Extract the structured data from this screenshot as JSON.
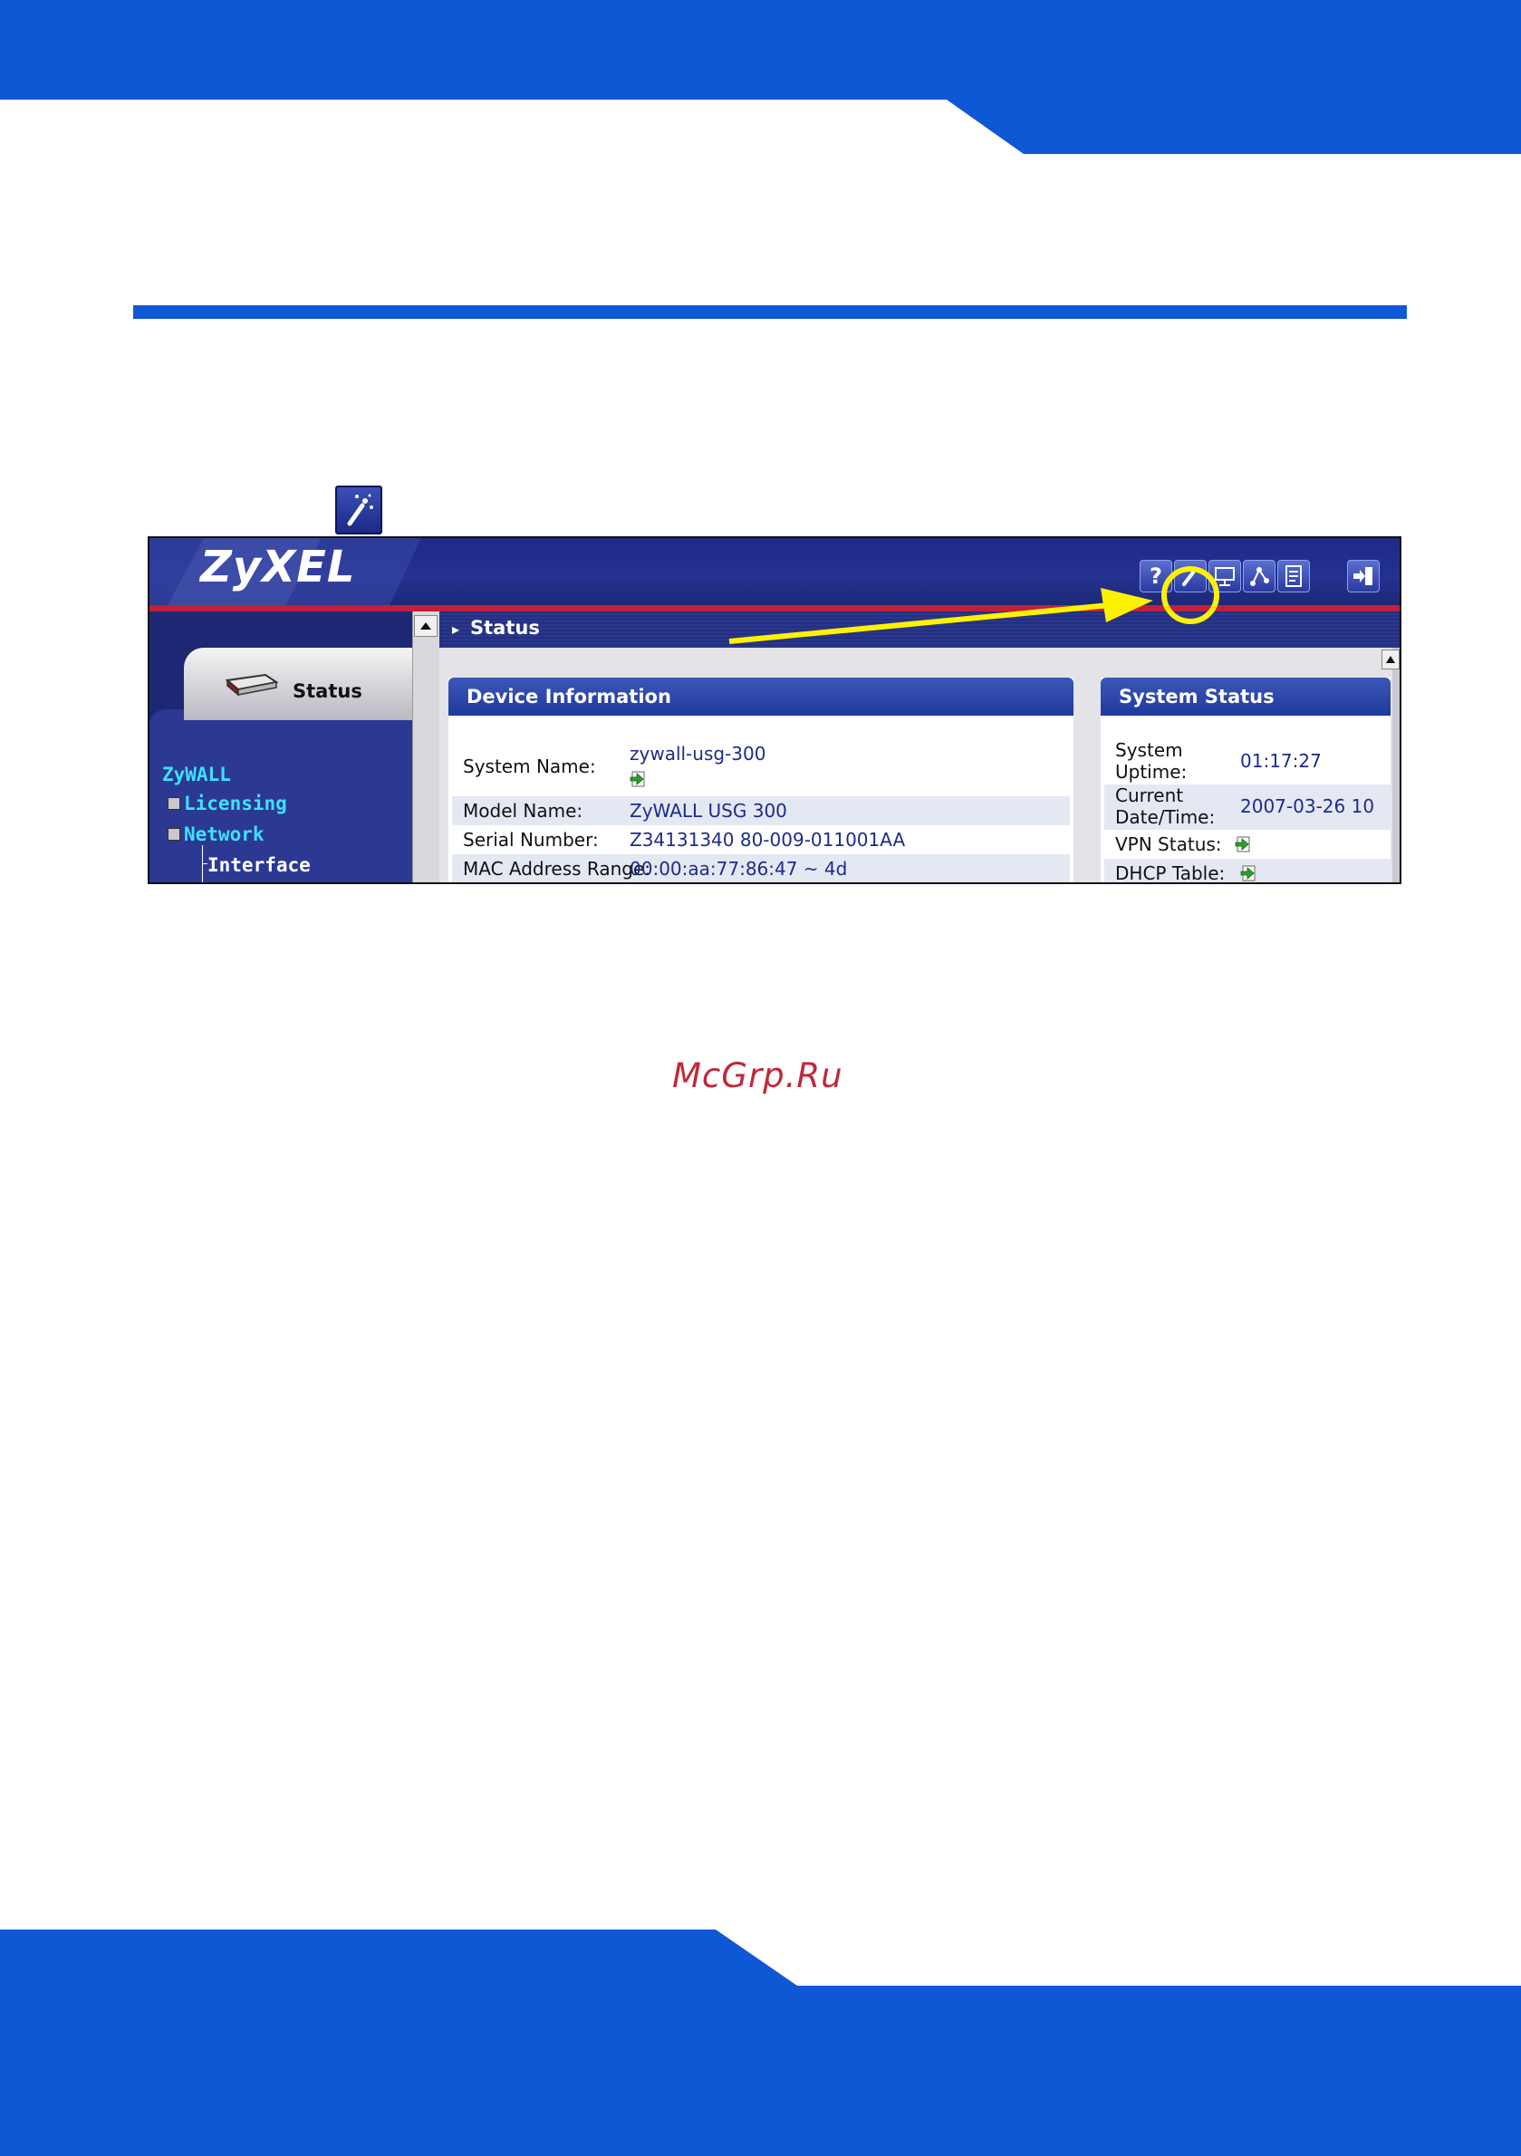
{
  "header": {
    "logo": "ZyXEL"
  },
  "toolbar": {
    "help_label": "?"
  },
  "nav": {
    "status_tab": "Status",
    "items": [
      {
        "label": "ZyWALL"
      },
      {
        "label": "Licensing"
      },
      {
        "label": "Network"
      },
      {
        "label": "Interface"
      }
    ]
  },
  "main": {
    "title": "Status"
  },
  "device_information": {
    "title": "Device Information",
    "rows": [
      {
        "label": "System Name:",
        "value": "zywall-usg-300"
      },
      {
        "label": "Model Name:",
        "value": "ZyWALL USG 300"
      },
      {
        "label": "Serial Number:",
        "value": "Z34131340 80-009-011001AA"
      },
      {
        "label": "MAC Address Range:",
        "value": "00:00:aa:77:86:47 ~ 4d"
      }
    ]
  },
  "system_status": {
    "title": "System Status",
    "rows": [
      {
        "label_line1": "System",
        "label_line2": "Uptime:",
        "value": "01:17:27"
      },
      {
        "label_line1": "Current",
        "label_line2": "Date/Time:",
        "value": "2007-03-26 10"
      },
      {
        "label": "VPN Status:"
      },
      {
        "label": "DHCP Table:"
      }
    ]
  },
  "watermark": "McGrp.Ru",
  "colors": {
    "page_blue": "#0e58d6",
    "header_navy": "#1f2a86",
    "accent_red": "#c0203a",
    "highlight_yellow": "#fff200",
    "link_cyan": "#3fe0ff",
    "watermark_red": "#c0283a"
  },
  "icons": {
    "wizard": "wand-icon",
    "toolbar": [
      "help-icon",
      "wizard-icon",
      "console-icon",
      "network-icon",
      "notes-icon",
      "logout-icon"
    ],
    "go": "go-arrow-icon"
  }
}
